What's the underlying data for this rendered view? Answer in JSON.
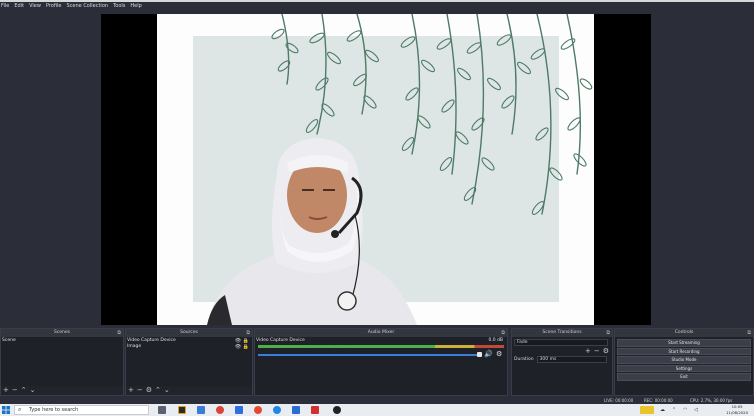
{
  "menu": [
    "File",
    "Edit",
    "View",
    "Profile",
    "Scene Collection",
    "Tools",
    "Help"
  ],
  "panels": {
    "scenes": {
      "title": "Scenes",
      "items": [
        "Scene"
      ]
    },
    "sources": {
      "title": "Sources",
      "items": [
        "Video Capture Device",
        "Image"
      ]
    },
    "mixer": {
      "title": "Audio Mixer",
      "channel": "Video Capture Device",
      "level": "0.0 dB"
    },
    "transitions": {
      "title": "Scene Transitions",
      "transition": "Fade",
      "duration_label": "Duration",
      "duration_value": "300 ms"
    },
    "controls": {
      "title": "Controls",
      "buttons": [
        "Start Streaming",
        "Start Recording",
        "Studio Mode",
        "Settings",
        "Exit"
      ]
    }
  },
  "status": {
    "live": "LIVE: 00:00:00",
    "rec": "REC: 00:00:00",
    "cpu": "CPU: 2.7%, 30.00 fps"
  },
  "taskbar": {
    "search_placeholder": "Type here to search",
    "time": "10:05",
    "date": "11/08/2020"
  },
  "colors": {
    "accent_green": "#4db04d",
    "volume_blue": "#3d7fd8",
    "leaf": "#4e7a66",
    "card": "#dde6e5"
  }
}
